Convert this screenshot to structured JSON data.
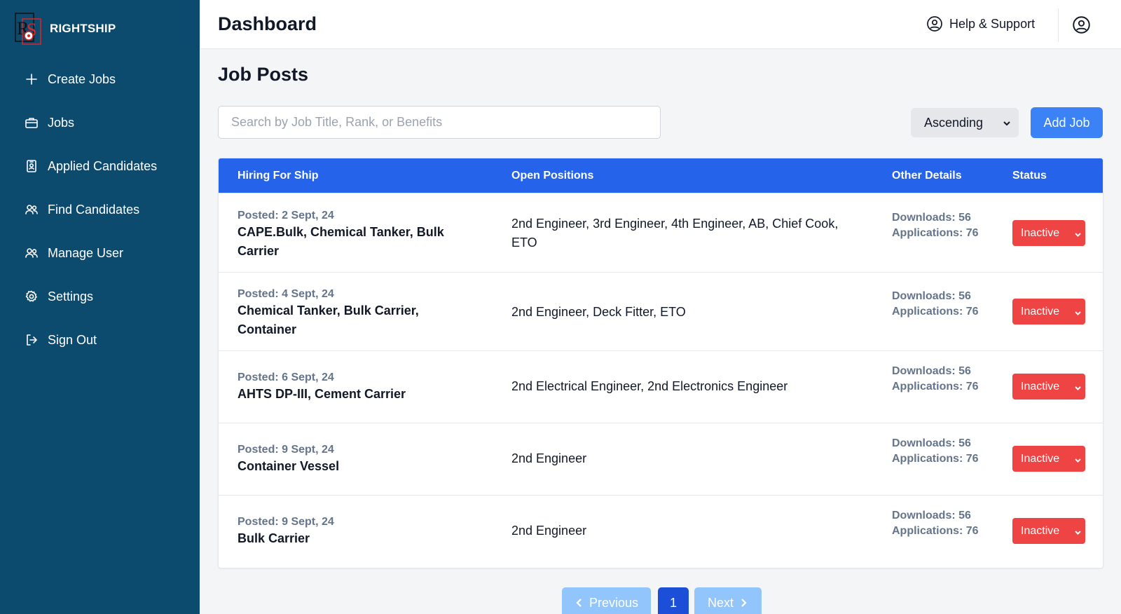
{
  "brand": {
    "name": "RIGHTSHIP",
    "logo_text": "RS"
  },
  "sidebar": {
    "items": [
      {
        "label": "Create Jobs",
        "icon": "plus-icon"
      },
      {
        "label": "Jobs",
        "icon": "briefcase-icon"
      },
      {
        "label": "Applied Candidates",
        "icon": "id-badge-icon"
      },
      {
        "label": "Find Candidates",
        "icon": "users-icon"
      },
      {
        "label": "Manage User",
        "icon": "users-icon"
      },
      {
        "label": "Settings",
        "icon": "gear-icon"
      },
      {
        "label": "Sign Out",
        "icon": "sign-out-icon"
      }
    ]
  },
  "header": {
    "title": "Dashboard",
    "help_label": "Help & Support"
  },
  "main": {
    "title": "Job Posts",
    "search_placeholder": "Search by Job Title, Rank, or Benefits",
    "sort_value": "Ascending",
    "add_button": "Add Job"
  },
  "table": {
    "headers": [
      "Hiring For Ship",
      "Open Positions",
      "Other Details",
      "Status"
    ],
    "rows": [
      {
        "posted": "Posted: 2 Sept, 24",
        "ships": "CAPE.Bulk, Chemical Tanker, Bulk Carrier",
        "positions": "2nd Engineer, 3rd Engineer, 4th Engineer, AB, Chief Cook, ETO",
        "downloads": "Downloads: 56",
        "applications": "Applications: 76",
        "status": "Inactive"
      },
      {
        "posted": "Posted: 4 Sept, 24",
        "ships": "Chemical Tanker, Bulk Carrier, Container",
        "positions": "2nd Engineer, Deck Fitter, ETO",
        "downloads": "Downloads: 56",
        "applications": "Applications: 76",
        "status": "Inactive"
      },
      {
        "posted": "Posted: 6 Sept, 24",
        "ships": "AHTS DP-III, Cement Carrier",
        "positions": "2nd Electrical Engineer, 2nd Electronics Engineer",
        "downloads": "Downloads: 56",
        "applications": "Applications: 76",
        "status": "Inactive"
      },
      {
        "posted": "Posted: 9 Sept, 24",
        "ships": "Container Vessel",
        "positions": "2nd Engineer",
        "downloads": "Downloads: 56",
        "applications": "Applications: 76",
        "status": "Inactive"
      },
      {
        "posted": "Posted: 9 Sept, 24",
        "ships": "Bulk Carrier",
        "positions": "2nd Engineer",
        "downloads": "Downloads: 56",
        "applications": "Applications: 76",
        "status": "Inactive"
      }
    ]
  },
  "pagination": {
    "previous": "Previous",
    "current": "1",
    "next": "Next"
  },
  "colors": {
    "sidebar": "#0c4a6e",
    "accent": "#3b82f6",
    "table_header": "#2563eb",
    "status_inactive": "#ef4444"
  }
}
